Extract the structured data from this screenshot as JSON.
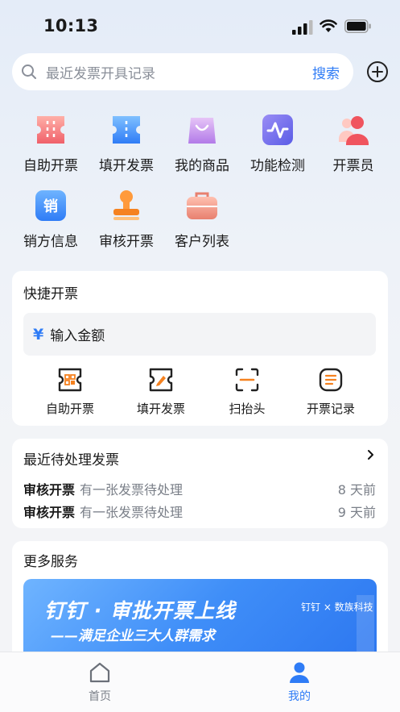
{
  "status": {
    "time": "10:13"
  },
  "search": {
    "placeholder": "最近发票开具记录",
    "button": "搜索"
  },
  "grid": [
    {
      "label": "自助开票",
      "icon": "self-invoice-icon"
    },
    {
      "label": "填开发票",
      "icon": "fill-invoice-icon"
    },
    {
      "label": "我的商品",
      "icon": "shopping-bag-icon"
    },
    {
      "label": "功能检测",
      "icon": "pulse-check-icon"
    },
    {
      "label": "开票员",
      "icon": "staff-icon"
    },
    {
      "label": "销方信息",
      "icon": "seller-info-icon"
    },
    {
      "label": "审核开票",
      "icon": "stamp-icon"
    },
    {
      "label": "客户列表",
      "icon": "briefcase-icon"
    }
  ],
  "quick": {
    "title": "快捷开票",
    "amount_symbol": "¥",
    "amount_placeholder": "输入金额",
    "actions": [
      {
        "label": "自助开票",
        "icon": "self-invoice-outline-icon"
      },
      {
        "label": "填开发票",
        "icon": "edit-invoice-outline-icon"
      },
      {
        "label": "扫抬头",
        "icon": "scan-icon"
      },
      {
        "label": "开票记录",
        "icon": "invoice-record-icon"
      }
    ]
  },
  "pending": {
    "title": "最近待处理发票",
    "rows": [
      {
        "type": "审核开票",
        "desc": "有一张发票待处理",
        "time": "8 天前"
      },
      {
        "type": "审核开票",
        "desc": "有一张发票待处理",
        "time": "9 天前"
      }
    ]
  },
  "more": {
    "title": "更多服务",
    "banner_title": "钉钉 · 审批开票上线",
    "banner_subtitle": "——满足企业三大人群需求",
    "banner_logo": "钉钉 × 数族科技"
  },
  "tabs": [
    {
      "label": "首页",
      "active": false
    },
    {
      "label": "我的",
      "active": true
    }
  ],
  "colors": {
    "accent": "#2f7cf6",
    "inactive": "#7a7f88"
  }
}
